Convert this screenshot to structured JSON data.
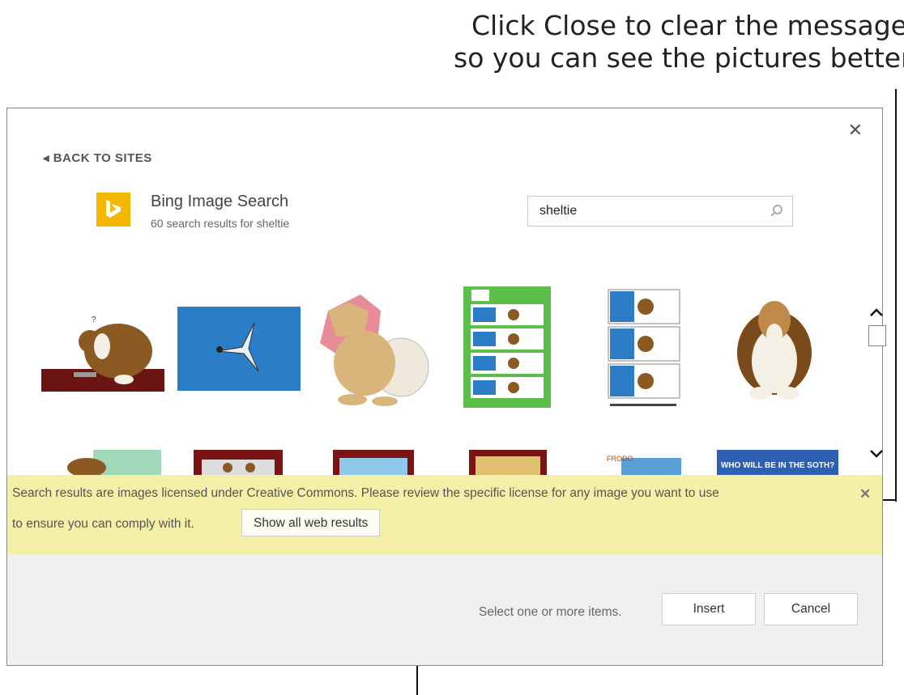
{
  "callout": {
    "line1": "Click Close to clear the message",
    "line2": "so you can see the pictures better"
  },
  "dialog": {
    "close_glyph": "✕",
    "back_label": "◂ BACK TO SITES",
    "provider": {
      "title": "Bing Image Search",
      "subtitle": "60 search results for sheltie",
      "icon": "bing-logo"
    },
    "search": {
      "value": "sheltie",
      "icon": "search-icon"
    },
    "scroll": {
      "up_glyph": "⌃",
      "down_glyph": "⌄"
    },
    "results_row2_caption": "WHO WILL BE IN THE SOTH?",
    "comic_caption": "FRODO"
  },
  "notice": {
    "text_line1": "Search results are images licensed under Creative Commons. Please review the specific license for any image you want to use",
    "text_line2": "to ensure you can comply with it.",
    "show_web_label": "Show all web results",
    "close_glyph": "✕"
  },
  "footer": {
    "hint": "Select one or more items.",
    "insert_label": "Insert",
    "cancel_label": "Cancel"
  },
  "colors": {
    "notice_bg": "#f5f0a8",
    "bing_yellow": "#f5b800",
    "footer_bg": "#f0f0f0"
  }
}
